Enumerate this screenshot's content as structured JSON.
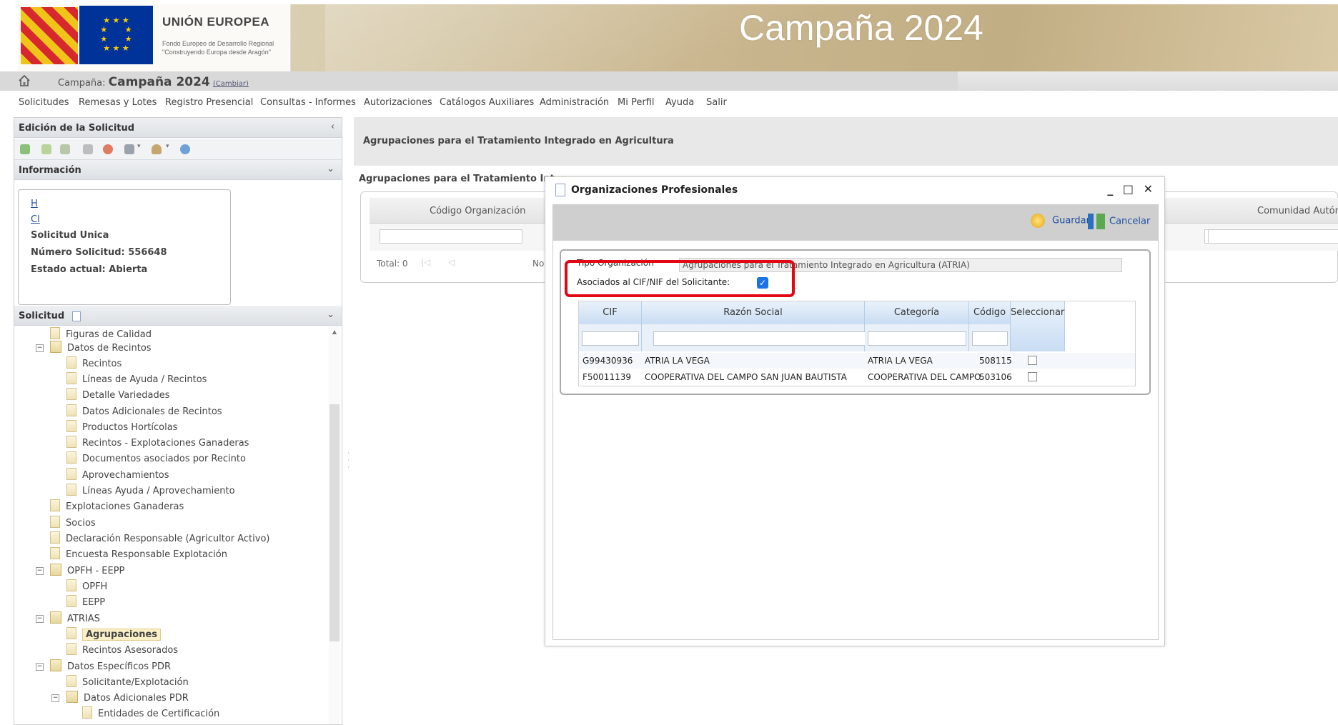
{
  "banner": {
    "logo_title": "UNIÓN EUROPEA",
    "logo_subtitle1": "Fondo Europeo de Desarrollo Regional",
    "logo_subtitle2": "\"Construyendo Europa desde Aragón\"",
    "campaign_title": "Campaña 2024"
  },
  "campaign_bar": {
    "label": "Campaña:",
    "value": "Campaña 2024",
    "change_link": "(Cambiar)"
  },
  "menu": [
    "Solicitudes",
    "Remesas y Lotes",
    "Registro Presencial",
    "Consultas - Informes",
    "Autorizaciones",
    "Catálogos Auxiliares",
    "Administración",
    "Mi Perfil",
    "Ayuda",
    "Salir"
  ],
  "left_panel": {
    "header": "Edición de la Solicitud",
    "collapse_icon": "‹",
    "info_header": "Información",
    "info_link1": "H",
    "info_link2": "Cl",
    "info_lines": [
      "Solicitud Unica",
      "Número Solicitud: 556648",
      "Estado actual: Abierta"
    ],
    "tree_header": "Solicitud",
    "tree": [
      "Figuras de Calidad",
      "Datos de Recintos",
      "Recintos",
      "Líneas de Ayuda / Recintos",
      "Detalle Variedades",
      "Datos Adicionales de Recintos",
      "Productos Hortícolas",
      "Recintos - Explotaciones Ganaderas",
      "Documentos asociados por Recinto",
      "Aprovechamientos",
      "Líneas Ayuda / Aprovechamiento",
      "Explotaciones Ganaderas",
      "Socios",
      "Declaración Responsable (Agricultor Activo)",
      "Encuesta Responsable Explotación",
      "OPFH - EEPP",
      "OPFH",
      "EEPP",
      "ATRIAS",
      "Agrupaciones",
      "Recintos Asesorados",
      "Datos Específicos PDR",
      "Solicitante/Explotación",
      "Datos Adicionales PDR",
      "Entidades de Certificación"
    ]
  },
  "main": {
    "header_title": "Agrupaciones para el Tratamiento Integrado en Agricultura",
    "sub_title": "Agrupaciones para el Tratamiento Int",
    "bg_grid": {
      "col1": "Código Organización",
      "col2": "Comunidad Autóno",
      "total": "Total: 0",
      "no_text": "No"
    }
  },
  "dialog": {
    "title": "Organizaciones Profesionales",
    "controls": "_ □ ✕",
    "save_label": "Guardar",
    "cancel_label": "Cancelar",
    "tipo_label": "Tipo Organización",
    "tipo_value": "Agrupaciones para el Tratamiento Integrado en Agricultura (ATRIA)",
    "asociados_label": "Asociados al CIF/NIF del Solicitante:",
    "asociados_checked": true,
    "columns": [
      "CIF",
      "Razón Social",
      "Categoría",
      "Código",
      "Seleccionar"
    ],
    "rows": [
      {
        "cif": "G99430936",
        "razon": "ATRIA LA VEGA",
        "categoria": "ATRIA LA VEGA",
        "codigo": "508115"
      },
      {
        "cif": "F50011139",
        "razon": "COOPERATIVA DEL CAMPO SAN JUAN BAUTISTA",
        "categoria": "COOPERATIVA DEL CAMPO",
        "codigo": "503106"
      }
    ]
  },
  "colors": {
    "highlight_box": "#e30613",
    "link_blue": "#1d4f9b",
    "checkbox_blue": "#1a73e8"
  }
}
